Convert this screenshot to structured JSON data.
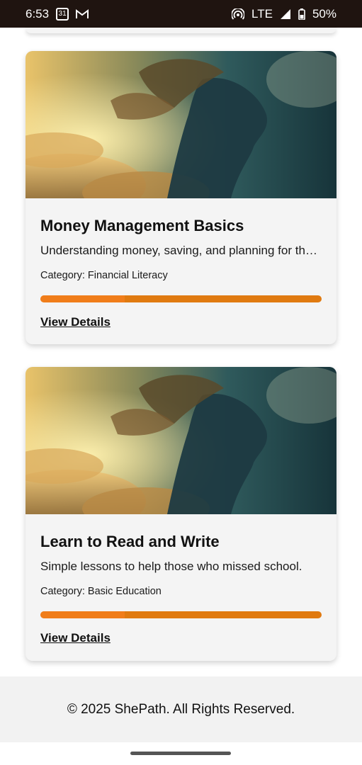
{
  "status_bar": {
    "time": "6:53",
    "calendar_day": "31",
    "network": "LTE",
    "battery": "50%",
    "icons": [
      "calendar-icon",
      "gmail-icon",
      "hotspot-icon",
      "signal-icon",
      "battery-icon"
    ]
  },
  "courses": [
    {
      "title": "Money Management Basics",
      "description": "Understanding money, saving, and planning for the future.",
      "category": "Category: Financial Literacy",
      "progress": 0.3,
      "link_label": "View Details"
    },
    {
      "title": "Learn to Read and Write",
      "description": "Simple lessons to help those who missed school.",
      "category": "Category: Basic Education",
      "progress": 0.3,
      "link_label": "View Details"
    }
  ],
  "footer": {
    "text": "© 2025 ShePath. All Rights Reserved."
  },
  "colors": {
    "progress_track": "#e07a10",
    "progress_fill": "#f07d1a",
    "status_bar_bg": "#1f1410",
    "card_bg": "#f4f4f4",
    "footer_bg": "#f2f2f2"
  }
}
